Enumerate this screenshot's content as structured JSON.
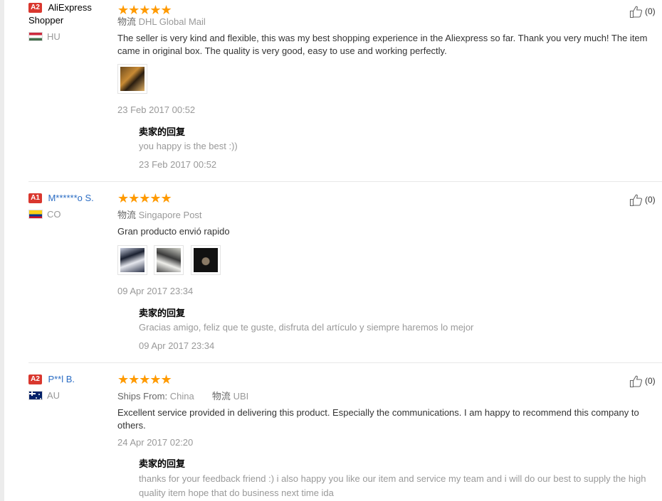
{
  "reviews": [
    {
      "level": "A2",
      "user": "AliExpress Shopper",
      "user_line2": "Shopper",
      "country": "HU",
      "stars": "★★★★★",
      "shipping_label": "物流",
      "shipping": "DHL Global Mail",
      "text": "The seller is very kind and flexible, this was my best shopping experience in the Aliexpress so far. Thank you very much! The item came in original box. The quality is very good, easy to use and working perfectly.",
      "date": "23 Feb 2017 00:52",
      "reply_title": "卖家的回复",
      "reply_text": "you happy is the best :))",
      "reply_date": "23 Feb 2017 00:52",
      "helpful": "(0)"
    },
    {
      "level": "A1",
      "user": "M******o S.",
      "country": "CO",
      "stars": "★★★★★",
      "shipping_label": "物流",
      "shipping": "Singapore Post",
      "text": "Gran producto envió rapido",
      "date": "09 Apr 2017 23:34",
      "reply_title": "卖家的回复",
      "reply_text": "Gracias amigo, feliz que te guste, disfruta del artículo y siempre haremos lo mejor",
      "reply_date": "09 Apr 2017 23:34",
      "helpful": "(0)"
    },
    {
      "level": "A2",
      "user": "P**l B.",
      "country": "AU",
      "stars": "★★★★★",
      "ships_from_label": "Ships From:",
      "ships_from": "China",
      "shipping_label": "物流",
      "shipping": "UBI",
      "text": "Excellent service provided in delivering this product. Especially the communications. I am happy to recommend this company to others.",
      "date": "24 Apr 2017 02:20",
      "reply_title": "卖家的回复",
      "reply_text": "thanks for your feedback friend :) i also happy you like our item and service my team and i will do our best to supply the high quality item hope that do business next time ida",
      "helpful": "(0)"
    }
  ],
  "colors": {
    "star": "#ff9a00",
    "level_badge": "#d9372e",
    "link": "#2a6cc4"
  },
  "icons": {
    "helpful": "thumbs-up-icon"
  }
}
